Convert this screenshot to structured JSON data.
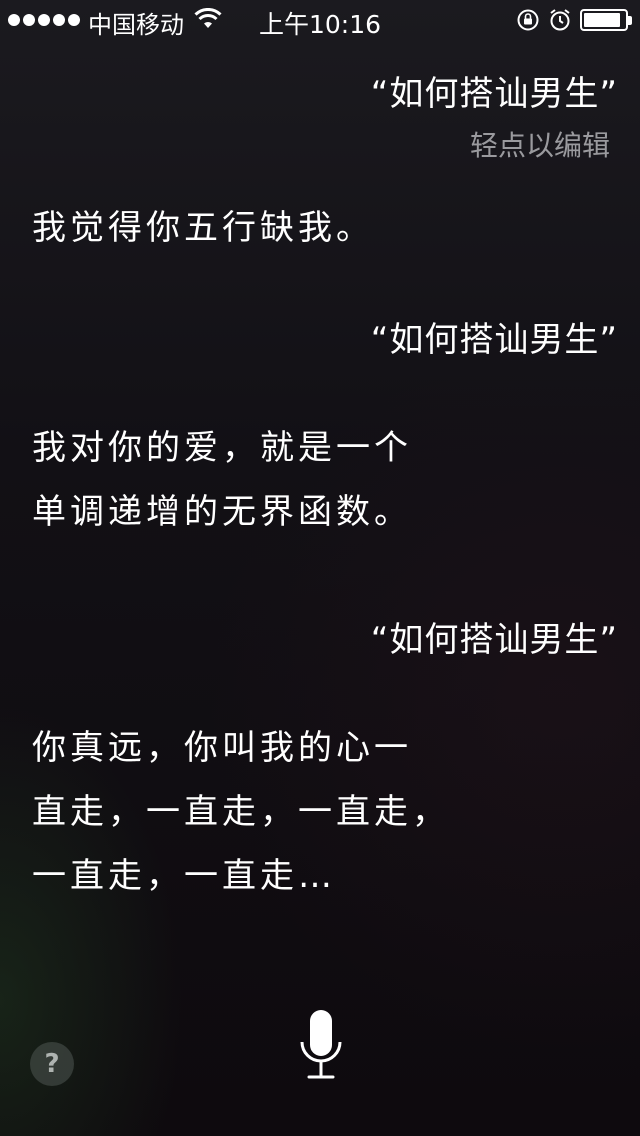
{
  "status_bar": {
    "carrier": "中国移动",
    "time": "上午10:16",
    "battery_level": 0.9
  },
  "conversation": {
    "query_1": "“如何搭讪男生”",
    "edit_hint": "轻点以编辑",
    "answer_1": [
      "我觉得你五行缺我。"
    ],
    "query_2": "“如何搭讪男生”",
    "answer_2": [
      "我对你的爱，就是一个",
      "单调递增的无界函数。"
    ],
    "query_3": "“如何搭讪男生”",
    "answer_3": [
      "你真远，你叫我的心一",
      "直走，一直走，一直走，",
      "一直走，一直走…"
    ]
  },
  "controls": {
    "help_label": "?"
  },
  "icons": {
    "wifi": "wifi-icon",
    "rotation_lock": "rotation-lock-icon",
    "alarm": "alarm-icon",
    "battery": "battery-icon",
    "microphone": "microphone-icon"
  },
  "colors": {
    "text": "#ffffff",
    "hint": "#9a9a9e",
    "background": "#121015"
  }
}
